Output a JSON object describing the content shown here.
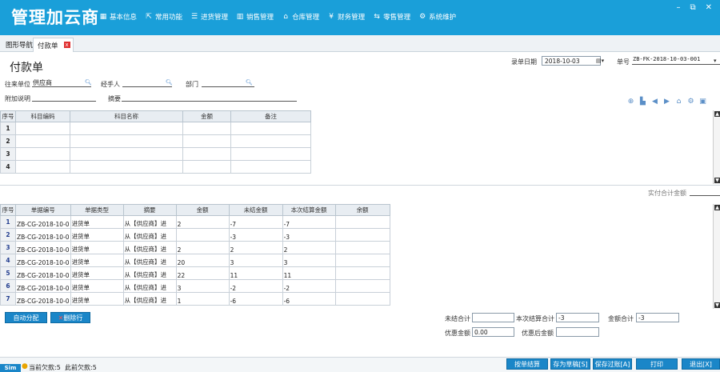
{
  "app": {
    "title": "管理加云商"
  },
  "menu": [
    {
      "icon": "grid-icon",
      "glyph": "▦",
      "label": "基本信息"
    },
    {
      "icon": "external-link-icon",
      "glyph": "⇱",
      "label": "常用功能"
    },
    {
      "icon": "list-icon",
      "glyph": "☰",
      "label": "进货管理"
    },
    {
      "icon": "bar-chart-icon",
      "glyph": "▥",
      "label": "销售管理"
    },
    {
      "icon": "house-icon",
      "glyph": "⌂",
      "label": "仓库管理"
    },
    {
      "icon": "yen-icon",
      "glyph": "¥",
      "label": "财务管理"
    },
    {
      "icon": "transfer-icon",
      "glyph": "⇆",
      "label": "零售管理"
    },
    {
      "icon": "gear-icon",
      "glyph": "⚙",
      "label": "系统维护"
    }
  ],
  "window": {
    "minimize": "–",
    "restore": "⧉",
    "close": "✕"
  },
  "tabs": {
    "nav": "图形导航",
    "payment": "付款单",
    "close": "x"
  },
  "form": {
    "title": "付款单",
    "date_label": "录单日期",
    "date_value": "2018-10-03",
    "no_label": "单号",
    "no_value": "ZB-FK-2018-10-03-001",
    "partner_label": "往来单位",
    "partner_value": "供应商",
    "handler_label": "经手人",
    "handler_value": "",
    "dept_label": "部门",
    "dept_value": "",
    "note_label": "附加说明",
    "note_value": "",
    "summary_label": "摘要",
    "summary_value": ""
  },
  "subject_table": {
    "headers": [
      "序号",
      "科目编码",
      "科目名称",
      "金额",
      "备注"
    ],
    "rows": [
      {
        "no": "1",
        "code": "",
        "name": "",
        "amount": "",
        "remark": ""
      },
      {
        "no": "2",
        "code": "",
        "name": "",
        "amount": "",
        "remark": ""
      },
      {
        "no": "3",
        "code": "",
        "name": "",
        "amount": "",
        "remark": ""
      },
      {
        "no": "4",
        "code": "",
        "name": "",
        "amount": "",
        "remark": ""
      }
    ],
    "total_label": "实付合计金额",
    "total_value": ""
  },
  "doc_table": {
    "headers": [
      "序号",
      "单据编号",
      "单据类型",
      "摘要",
      "金额",
      "未结金额",
      "本次结算金额",
      "余额"
    ],
    "rows": [
      {
        "no": "1",
        "doc_no": "ZB-CG-2018-10-0",
        "type": "进货单",
        "summary": "从【供应商】进",
        "amount": "2",
        "unsettled": "-7",
        "settle": "-7",
        "balance": ""
      },
      {
        "no": "2",
        "doc_no": "ZB-CG-2018-10-0",
        "type": "进货单",
        "summary": "从【供应商】进",
        "amount": "",
        "unsettled": "-3",
        "settle": "-3",
        "balance": ""
      },
      {
        "no": "3",
        "doc_no": "ZB-CG-2018-10-0",
        "type": "进货单",
        "summary": "从【供应商】进",
        "amount": "2",
        "unsettled": "2",
        "settle": "2",
        "balance": ""
      },
      {
        "no": "4",
        "doc_no": "ZB-CG-2018-10-0",
        "type": "进货单",
        "summary": "从【供应商】进",
        "amount": "20",
        "unsettled": "3",
        "settle": "3",
        "balance": ""
      },
      {
        "no": "5",
        "doc_no": "ZB-CG-2018-10-0",
        "type": "进货单",
        "summary": "从【供应商】进",
        "amount": "22",
        "unsettled": "11",
        "settle": "11",
        "balance": ""
      },
      {
        "no": "6",
        "doc_no": "ZB-CG-2018-10-0",
        "type": "进货单",
        "summary": "从【供应商】进",
        "amount": "3",
        "unsettled": "-2",
        "settle": "-2",
        "balance": ""
      },
      {
        "no": "7",
        "doc_no": "ZB-CG-2018-10-0",
        "type": "进货单",
        "summary": "从【供应商】进",
        "amount": "1",
        "unsettled": "-6",
        "settle": "-6",
        "balance": ""
      }
    ]
  },
  "actions": {
    "auto_allocate": "自动分配",
    "delete_row": "删除行"
  },
  "totals": {
    "unsettled_label": "未结合计",
    "unsettled_value": "",
    "settle_label": "本次结算合计",
    "settle_value": "-3",
    "amount_label": "金额合计",
    "amount_value": "-3",
    "discount_label": "优惠金额",
    "discount_value": "0.00",
    "after_discount_label": "优惠后金额",
    "after_discount_value": ""
  },
  "footer_buttons": {
    "settle_by_doc": "按单结算",
    "save_draft": "存为草稿[S]",
    "save_post": "保存过账[A]",
    "print": "打印",
    "exit": "退出[X]"
  },
  "status": {
    "logo_text": "Sim",
    "prev_debt": "当前欠款:5",
    "prior_debt": "此前欠款:5"
  }
}
